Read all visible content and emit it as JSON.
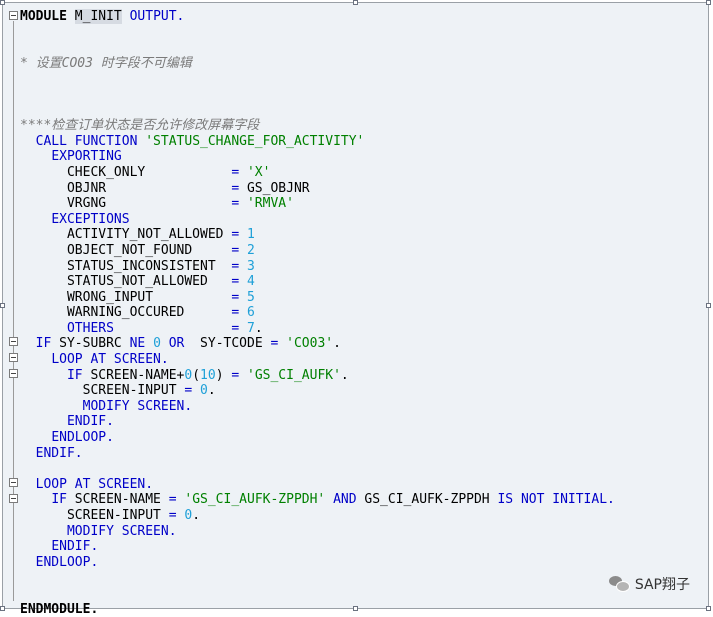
{
  "code_lines": [
    [
      {
        "t": "MODULE",
        "c": "bold"
      },
      {
        "t": " "
      },
      {
        "t": "M_INIT",
        "c": "hl"
      },
      {
        "t": " "
      },
      {
        "t": "OUTPUT.",
        "c": "kw"
      }
    ],
    [],
    [],
    [
      {
        "t": "* 设置CO03 时字段不可编辑",
        "c": "cmt"
      }
    ],
    [],
    [],
    [],
    [
      {
        "t": "****检查订单状态是否允许修改屏幕字段",
        "c": "cmt"
      }
    ],
    [
      {
        "t": "  "
      },
      {
        "t": "CALL FUNCTION",
        "c": "kw"
      },
      {
        "t": " "
      },
      {
        "t": "'STATUS_CHANGE_FOR_ACTIVITY'",
        "c": "str"
      }
    ],
    [
      {
        "t": "    "
      },
      {
        "t": "EXPORTING",
        "c": "kw"
      }
    ],
    [
      {
        "t": "      CHECK_ONLY           "
      },
      {
        "t": "=",
        "c": "kw"
      },
      {
        "t": " "
      },
      {
        "t": "'X'",
        "c": "str"
      }
    ],
    [
      {
        "t": "      OBJNR                "
      },
      {
        "t": "=",
        "c": "kw"
      },
      {
        "t": " GS_OBJNR"
      }
    ],
    [
      {
        "t": "      VRGNG                "
      },
      {
        "t": "=",
        "c": "kw"
      },
      {
        "t": " "
      },
      {
        "t": "'RMVA'",
        "c": "str"
      }
    ],
    [
      {
        "t": "    "
      },
      {
        "t": "EXCEPTIONS",
        "c": "kw"
      }
    ],
    [
      {
        "t": "      ACTIVITY_NOT_ALLOWED "
      },
      {
        "t": "=",
        "c": "kw"
      },
      {
        "t": " "
      },
      {
        "t": "1",
        "c": "num"
      }
    ],
    [
      {
        "t": "      OBJECT_NOT_FOUND     "
      },
      {
        "t": "=",
        "c": "kw"
      },
      {
        "t": " "
      },
      {
        "t": "2",
        "c": "num"
      }
    ],
    [
      {
        "t": "      STATUS_INCONSISTENT  "
      },
      {
        "t": "=",
        "c": "kw"
      },
      {
        "t": " "
      },
      {
        "t": "3",
        "c": "num"
      }
    ],
    [
      {
        "t": "      STATUS_NOT_ALLOWED   "
      },
      {
        "t": "=",
        "c": "kw"
      },
      {
        "t": " "
      },
      {
        "t": "4",
        "c": "num"
      }
    ],
    [
      {
        "t": "      WRONG_INPUT          "
      },
      {
        "t": "=",
        "c": "kw"
      },
      {
        "t": " "
      },
      {
        "t": "5",
        "c": "num"
      }
    ],
    [
      {
        "t": "      WARNING_OCCURED      "
      },
      {
        "t": "=",
        "c": "kw"
      },
      {
        "t": " "
      },
      {
        "t": "6",
        "c": "num"
      }
    ],
    [
      {
        "t": "      "
      },
      {
        "t": "OTHERS",
        "c": "kw"
      },
      {
        "t": "               "
      },
      {
        "t": "=",
        "c": "kw"
      },
      {
        "t": " "
      },
      {
        "t": "7",
        "c": "num"
      },
      {
        "t": "."
      }
    ],
    [
      {
        "t": "  "
      },
      {
        "t": "IF",
        "c": "kw"
      },
      {
        "t": " SY-SUBRC "
      },
      {
        "t": "NE",
        "c": "kw"
      },
      {
        "t": " "
      },
      {
        "t": "0",
        "c": "num"
      },
      {
        "t": " "
      },
      {
        "t": "OR",
        "c": "kw"
      },
      {
        "t": "  SY-TCODE "
      },
      {
        "t": "=",
        "c": "kw"
      },
      {
        "t": " "
      },
      {
        "t": "'CO03'",
        "c": "str"
      },
      {
        "t": "."
      }
    ],
    [
      {
        "t": "    "
      },
      {
        "t": "LOOP AT SCREEN.",
        "c": "kw"
      }
    ],
    [
      {
        "t": "      "
      },
      {
        "t": "IF",
        "c": "kw"
      },
      {
        "t": " SCREEN-NAME+"
      },
      {
        "t": "0",
        "c": "num"
      },
      {
        "t": "("
      },
      {
        "t": "10",
        "c": "num"
      },
      {
        "t": ") "
      },
      {
        "t": "=",
        "c": "kw"
      },
      {
        "t": " "
      },
      {
        "t": "'GS_CI_AUFK'",
        "c": "str"
      },
      {
        "t": "."
      }
    ],
    [
      {
        "t": "        SCREEN-INPUT "
      },
      {
        "t": "=",
        "c": "kw"
      },
      {
        "t": " "
      },
      {
        "t": "0",
        "c": "num"
      },
      {
        "t": "."
      }
    ],
    [
      {
        "t": "        "
      },
      {
        "t": "MODIFY SCREEN.",
        "c": "kw"
      }
    ],
    [
      {
        "t": "      "
      },
      {
        "t": "ENDIF.",
        "c": "kw"
      }
    ],
    [
      {
        "t": "    "
      },
      {
        "t": "ENDLOOP.",
        "c": "kw"
      }
    ],
    [
      {
        "t": "  "
      },
      {
        "t": "ENDIF.",
        "c": "kw"
      }
    ],
    [],
    [
      {
        "t": "  "
      },
      {
        "t": "LOOP AT SCREEN.",
        "c": "kw"
      }
    ],
    [
      {
        "t": "    "
      },
      {
        "t": "IF",
        "c": "kw"
      },
      {
        "t": " SCREEN-NAME "
      },
      {
        "t": "=",
        "c": "kw"
      },
      {
        "t": " "
      },
      {
        "t": "'GS_CI_AUFK-ZPPDH'",
        "c": "str"
      },
      {
        "t": " "
      },
      {
        "t": "AND",
        "c": "kw"
      },
      {
        "t": " GS_CI_AUFK-ZPPDH "
      },
      {
        "t": "IS NOT INITIAL.",
        "c": "kw"
      }
    ],
    [
      {
        "t": "      SCREEN-INPUT "
      },
      {
        "t": "=",
        "c": "kw"
      },
      {
        "t": " "
      },
      {
        "t": "0",
        "c": "num"
      },
      {
        "t": "."
      }
    ],
    [
      {
        "t": "      "
      },
      {
        "t": "MODIFY SCREEN.",
        "c": "kw"
      }
    ],
    [
      {
        "t": "    "
      },
      {
        "t": "ENDIF.",
        "c": "kw"
      }
    ],
    [
      {
        "t": "  "
      },
      {
        "t": "ENDLOOP.",
        "c": "kw"
      }
    ],
    [],
    [],
    [
      {
        "t": "ENDMODULE.",
        "c": "bold"
      }
    ]
  ],
  "watermark": {
    "text": "SAP翔子",
    "icon": "wechat-icon"
  },
  "colors": {
    "keyword": "#0000c8",
    "string": "#008000",
    "number": "#1ea0d8",
    "comment": "#7a7a7a",
    "background": "#eef2f6"
  }
}
